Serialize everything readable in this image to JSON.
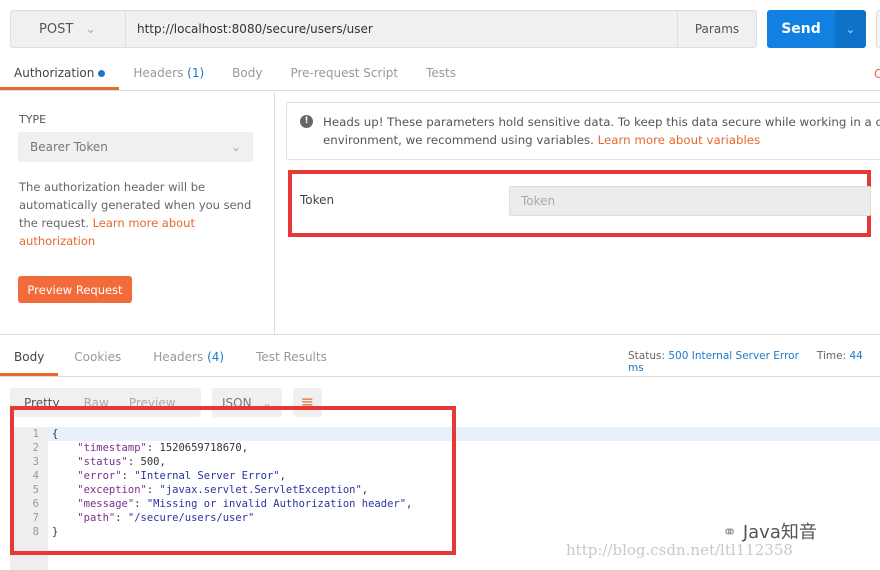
{
  "request": {
    "method": "POST",
    "url": "http://localhost:8080/secure/users/user",
    "params_label": "Params",
    "send_label": "Send"
  },
  "request_tabs": [
    {
      "label": "Authorization",
      "active": true
    },
    {
      "label": "Headers",
      "count": "(1)"
    },
    {
      "label": "Body"
    },
    {
      "label": "Pre-request Script"
    },
    {
      "label": "Tests"
    }
  ],
  "truncated_right_link": "C",
  "auth": {
    "type_label": "TYPE",
    "type_value": "Bearer Token",
    "description": "The authorization header will be automatically generated when you send the request. ",
    "learn_more": "Learn more about authorization",
    "preview_button": "Preview Request"
  },
  "alert": {
    "line1": "Heads up! These parameters hold sensitive data. To keep this data secure while working in a collabo",
    "line2": "environment, we recommend using variables. ",
    "link": "Learn more about variables"
  },
  "token": {
    "label": "Token",
    "placeholder": "Token"
  },
  "response_tabs": [
    {
      "label": "Body",
      "active": true
    },
    {
      "label": "Cookies"
    },
    {
      "label": "Headers",
      "count": "(4)"
    },
    {
      "label": "Test Results"
    }
  ],
  "status": {
    "status_label": "Status:",
    "status_value": "500 Internal Server Error",
    "time_label": "Time:",
    "time_value": "44 ms"
  },
  "view_modes": [
    "Pretty",
    "Raw",
    "Preview"
  ],
  "format": "JSON",
  "code_lines": [
    {
      "n": "1",
      "t": "{"
    },
    {
      "n": "2",
      "k": "\"timestamp\"",
      "v": "1520659718670",
      "num": true,
      "c": ","
    },
    {
      "n": "3",
      "k": "\"status\"",
      "v": "500",
      "num": true,
      "c": ","
    },
    {
      "n": "4",
      "k": "\"error\"",
      "v": "\"Internal Server Error\"",
      "c": ","
    },
    {
      "n": "5",
      "k": "\"exception\"",
      "v": "\"javax.servlet.ServletException\"",
      "c": ","
    },
    {
      "n": "6",
      "k": "\"message\"",
      "v": "\"Missing or invalid Authorization header\"",
      "c": ","
    },
    {
      "n": "7",
      "k": "\"path\"",
      "v": "\"/secure/users/user\"",
      "c": ""
    },
    {
      "n": "8",
      "t": "}"
    }
  ],
  "watermark": {
    "brand": "Java知音",
    "url": "http://blog.csdn.net/ltl112358"
  },
  "colors": {
    "accent": "#e8692c",
    "send": "#1280e0",
    "highlight": "#e53935"
  }
}
